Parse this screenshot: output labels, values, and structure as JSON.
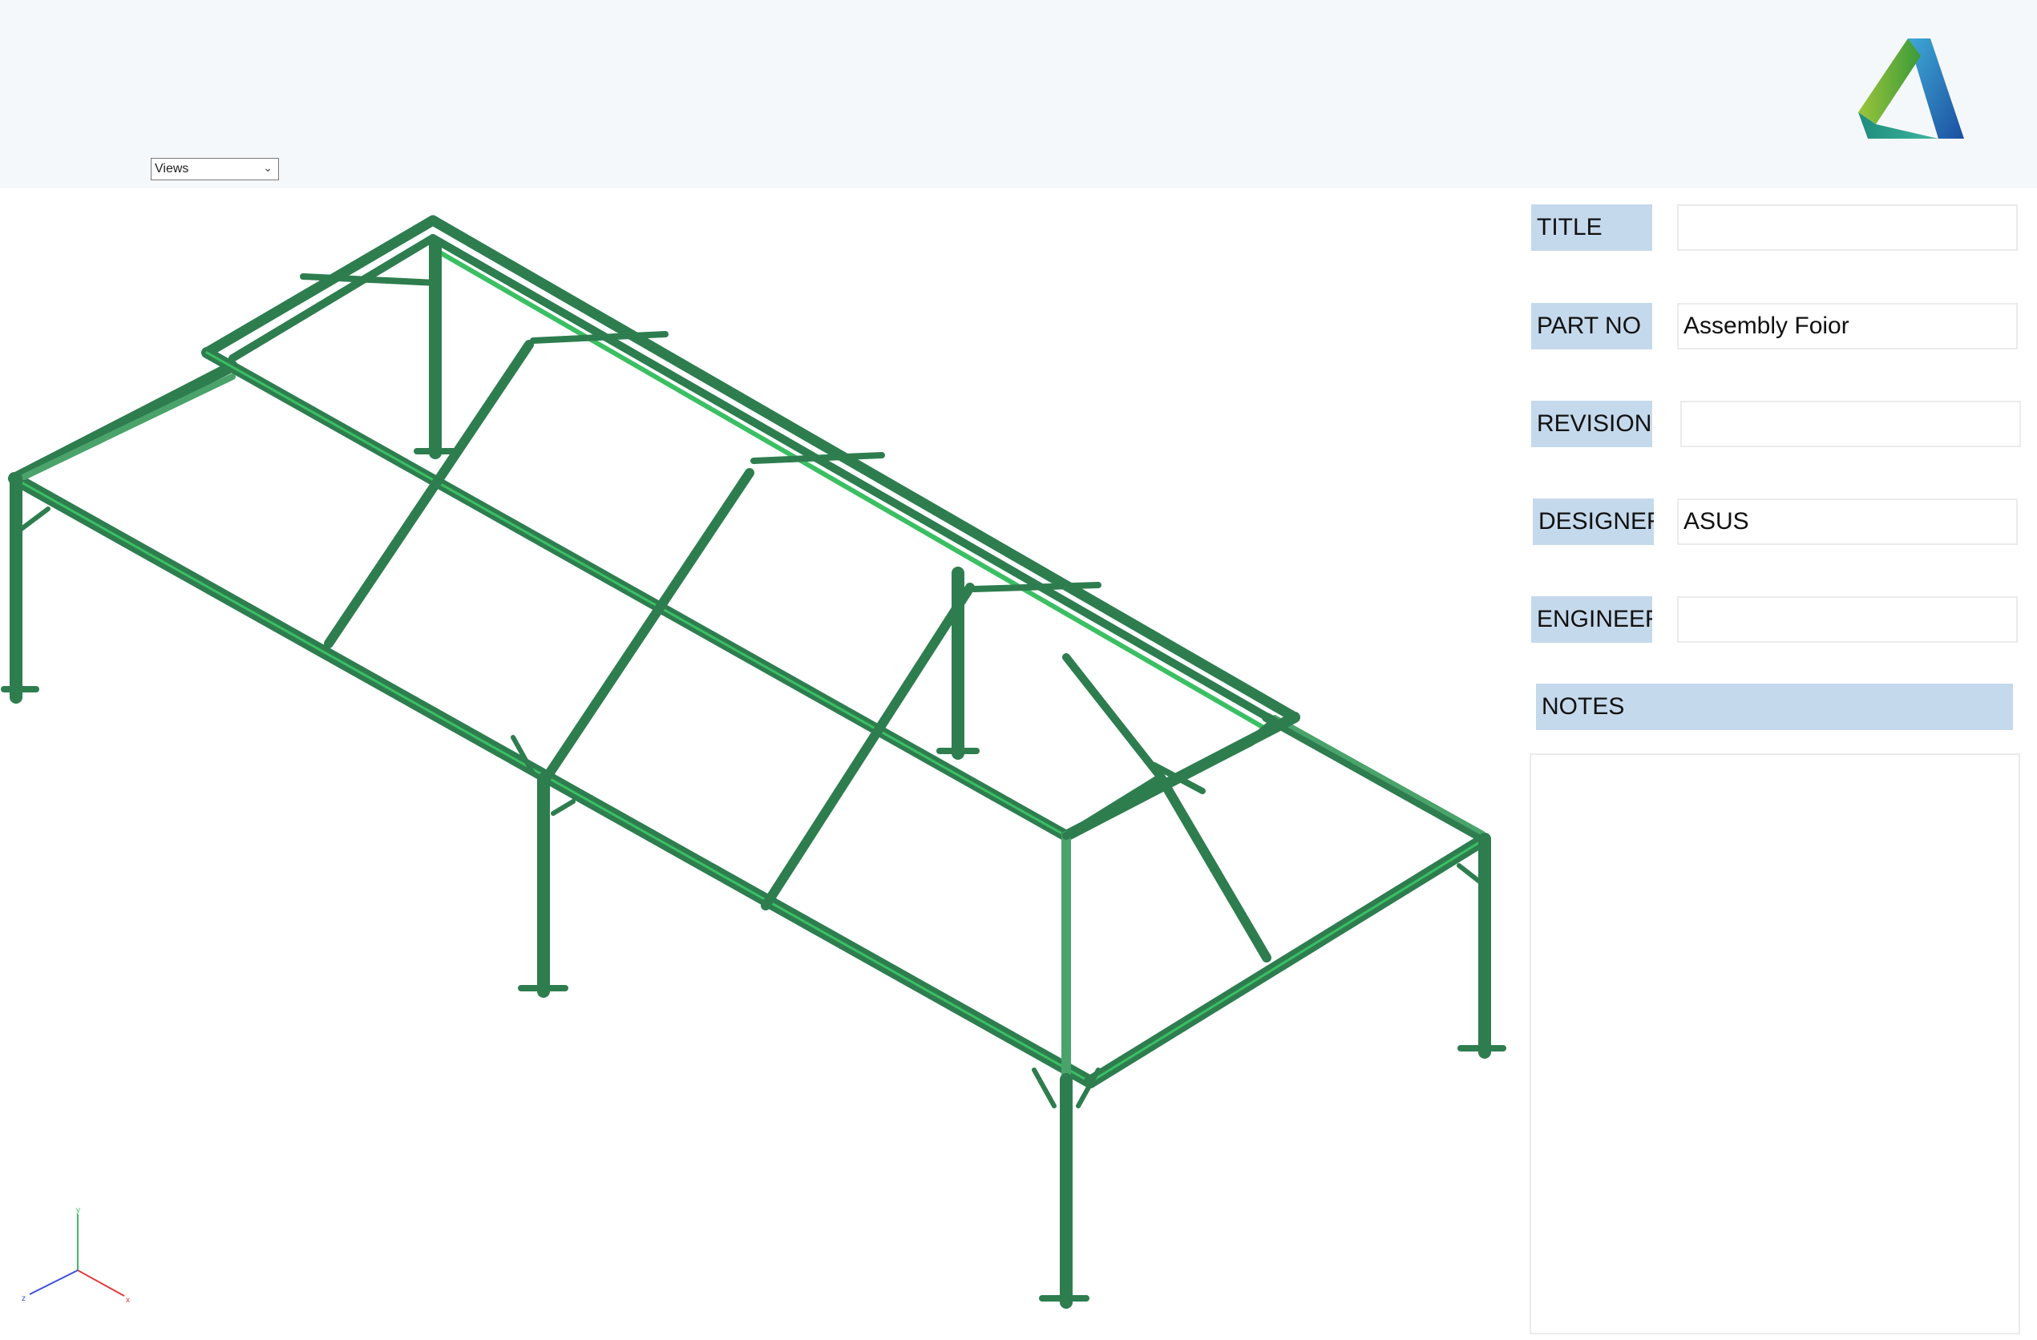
{
  "header": {
    "logo_icon": "autodesk-logo-icon",
    "views_dropdown": {
      "selected": "Views",
      "icon": "chevron-down-icon"
    }
  },
  "viewport": {
    "model_color": "#2e7d4f",
    "axis_triad": {
      "y_label": "y",
      "x_label": "x",
      "z_label": "z"
    }
  },
  "properties": {
    "title": {
      "label": "TITLE",
      "value": ""
    },
    "part_no": {
      "label": "PART NO",
      "value": "Assembly Foior"
    },
    "revision": {
      "label": "REVISION",
      "value": ""
    },
    "designer": {
      "label": "DESIGNER",
      "value": "ASUS"
    },
    "engineer": {
      "label": "ENGINEER",
      "value": ""
    },
    "notes": {
      "label": "NOTES",
      "value": ""
    }
  },
  "colors": {
    "label_bg": "#c5d9ec",
    "header_bg": "#f5f8fb",
    "steel": "#2e7d4f"
  }
}
